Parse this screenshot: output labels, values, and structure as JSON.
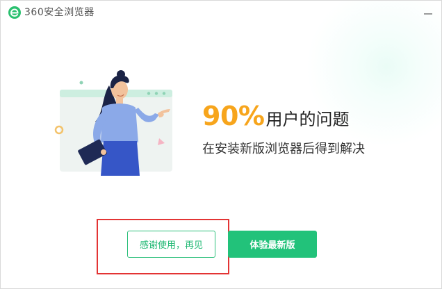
{
  "window": {
    "title": "360安全浏览器",
    "close_label": "—"
  },
  "main": {
    "headline_percent": "90%",
    "headline_text": "用户的问题",
    "subline": "在安装新版浏览器后得到解决"
  },
  "buttons": {
    "thanks_label": "感谢使用，再见",
    "try_label": "体验最新版"
  },
  "colors": {
    "accent_green": "#22c27a",
    "percent_orange": "#f7a51c",
    "highlight_red": "#e33434"
  },
  "icons": {
    "logo": "360-browser-logo-icon",
    "close": "minimize-icon",
    "illustration": "woman-presenting-illustration"
  }
}
